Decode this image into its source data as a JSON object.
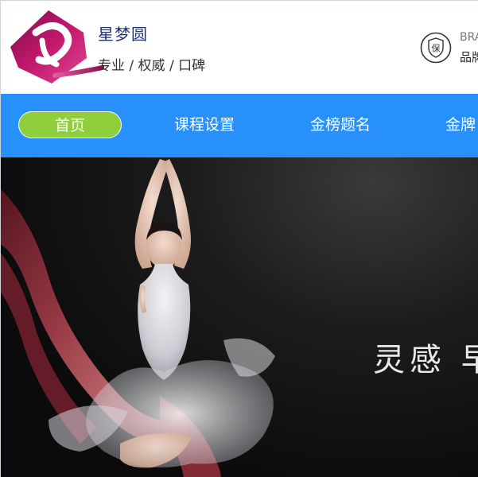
{
  "header": {
    "brand_name": "星梦圆",
    "slogan": "专业 / 权威 / 口碑",
    "guarantee": {
      "icon": "shield-guarantee-icon",
      "icon_glyph": "保",
      "label_en": "BRA",
      "label_cn": "品牌"
    }
  },
  "nav": {
    "items": [
      {
        "label": "首页",
        "active": true
      },
      {
        "label": "课程设置",
        "active": false
      },
      {
        "label": "金榜题名",
        "active": false
      },
      {
        "label": "金牌",
        "active": false
      }
    ]
  },
  "hero": {
    "headline": "灵感 早"
  },
  "colors": {
    "nav_bg": "#2790fb",
    "nav_active": "#8fcf3c",
    "brand_text": "#1e2f7a",
    "logo_magenta": "#b0125f"
  }
}
